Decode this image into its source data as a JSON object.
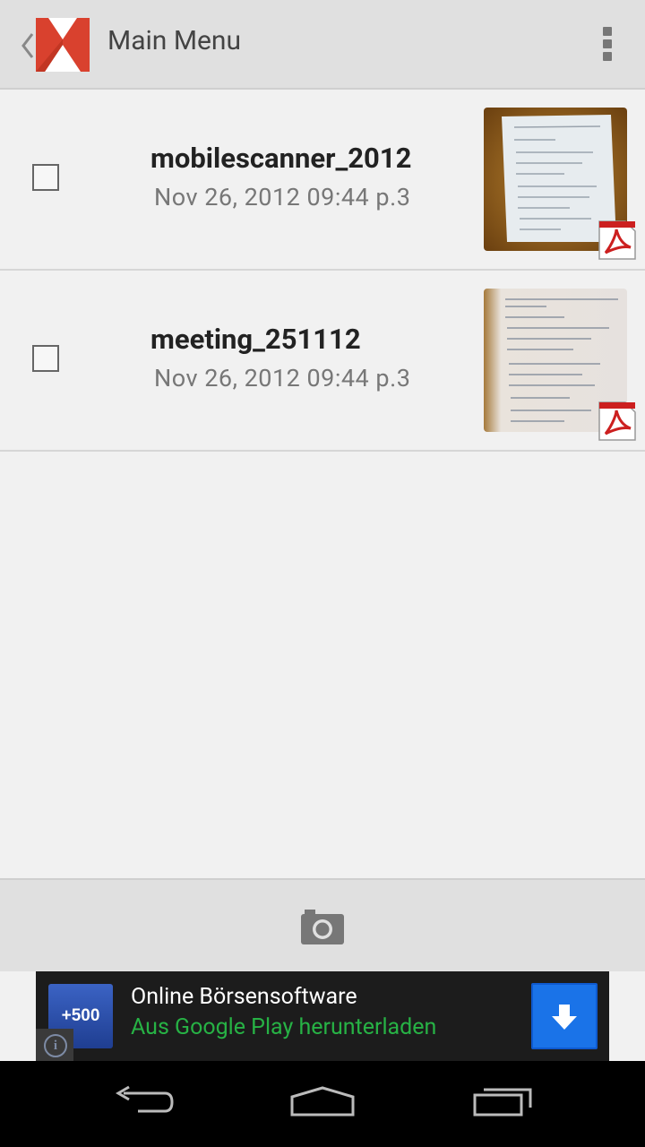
{
  "actionbar": {
    "title": "Main Menu",
    "icons": [
      "back-chevron-icon",
      "app-logo-icon",
      "overflow-menu-icon"
    ]
  },
  "documents": [
    {
      "name": "mobilescanner_2012",
      "meta": "Nov 26, 2012 09:44 p.3",
      "checked": false,
      "type": "pdf"
    },
    {
      "name": "meeting_251112",
      "meta": "Nov 26, 2012 09:44 p.3",
      "checked": false,
      "type": "pdf"
    }
  ],
  "bottombar": {
    "icon": "camera-icon"
  },
  "ad": {
    "app_icon_text": "+500",
    "title": "Online Börsensoftware",
    "subtitle": "Aus Google Play herunterladen",
    "icons": [
      "info-icon",
      "download-icon"
    ]
  },
  "navbar": {
    "icons": [
      "back-icon",
      "home-icon",
      "recent-apps-icon"
    ]
  },
  "colors": {
    "actionbar_bg": "#e0e0e0",
    "logo_red": "#d9412e",
    "ad_subtitle_green": "#27b245",
    "ad_button_blue": "#1a73e8",
    "pdf_red": "#cc1f1f"
  }
}
